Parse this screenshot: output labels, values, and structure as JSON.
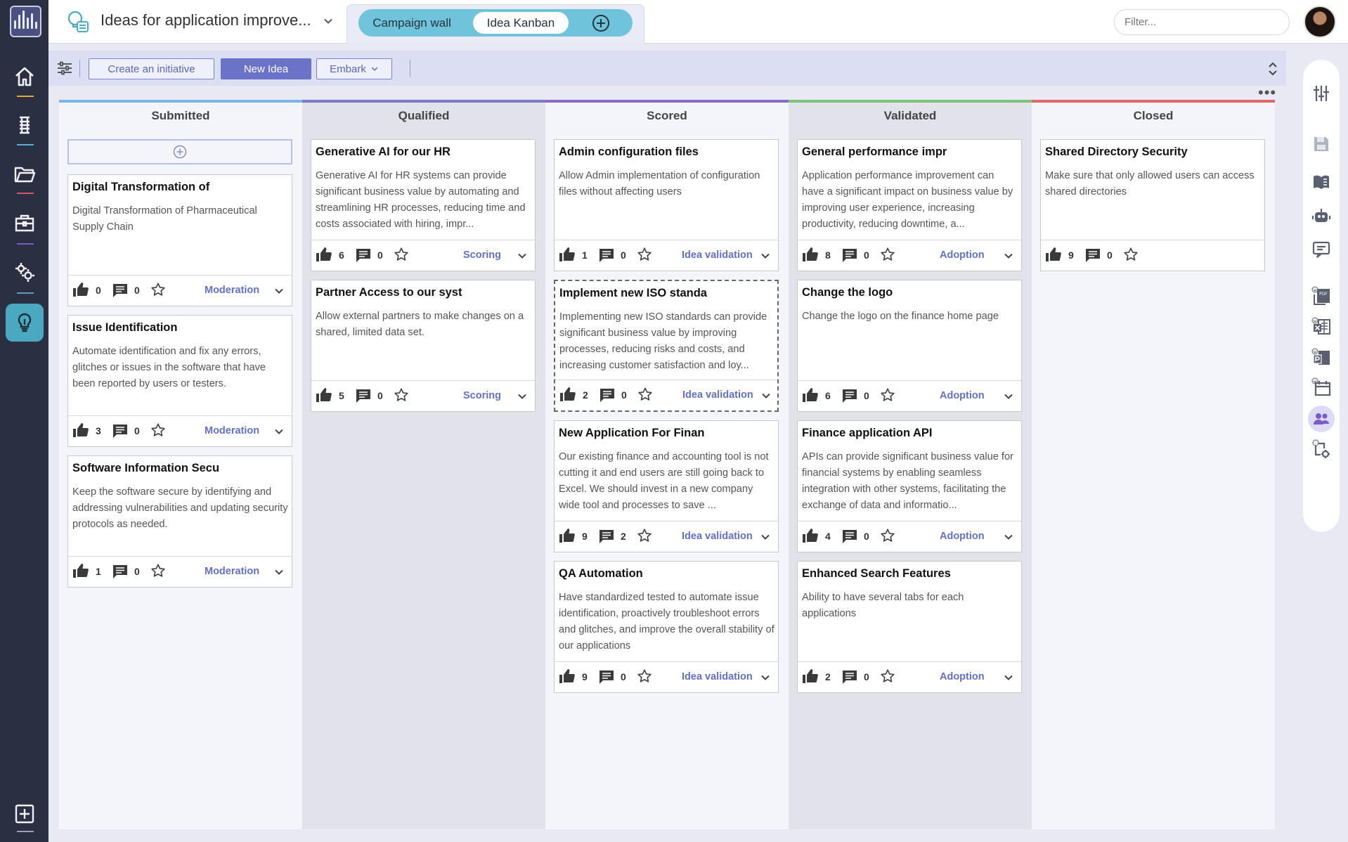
{
  "header": {
    "title": "Ideas for application improve...",
    "tabs": [
      {
        "label": "Campaign wall",
        "active": false
      },
      {
        "label": "Idea Kanban",
        "active": true
      }
    ],
    "filter_placeholder": "Filter..."
  },
  "toolbar": {
    "create_initiative": "Create an initiative",
    "new_idea": "New Idea",
    "embark": "Embark"
  },
  "colors": {
    "submitted": "#7ab6e8",
    "qualified": "#7d78c8",
    "scored": "#8a6cc6",
    "validated": "#7dc47a",
    "closed": "#e06868",
    "accent": "#6b73c9",
    "nav_active": "#4aa8c0"
  },
  "columns": [
    {
      "title": "Submitted",
      "cards": [
        {
          "title": "Digital Transformation of",
          "description": "Digital Transformation of Pharmaceutical Supply Chain",
          "likes": "0",
          "comments": "0",
          "stage": "Moderation"
        },
        {
          "title": "Issue Identification",
          "description": "Automate identification and fix any errors, glitches or issues in the software that have been reported by users or testers.",
          "likes": "3",
          "comments": "0",
          "stage": "Moderation"
        },
        {
          "title": "Software Information Secu",
          "description": "Keep the software secure by identifying and addressing vulnerabilities and updating security protocols as needed.",
          "likes": "1",
          "comments": "0",
          "stage": "Moderation"
        }
      ]
    },
    {
      "title": "Qualified",
      "cards": [
        {
          "title": "Generative AI for our HR",
          "description": "Generative AI for HR systems can provide significant business value by automating and streamlining HR processes, reducing time and costs associated with hiring, impr...",
          "likes": "6",
          "comments": "0",
          "stage": "Scoring"
        },
        {
          "title": "Partner Access to our syst",
          "description": "Allow external partners to make changes on a shared, limited data set.",
          "likes": "5",
          "comments": "0",
          "stage": "Scoring"
        }
      ]
    },
    {
      "title": "Scored",
      "cards": [
        {
          "title": "Admin configuration files",
          "description": "Allow Admin implementation of configuration files without affecting users",
          "likes": "1",
          "comments": "0",
          "stage": "Idea validation"
        },
        {
          "title": "Implement new ISO standa",
          "description": "Implementing new ISO standards can provide significant business value by improving processes, reducing risks and costs, and increasing customer satisfaction and loy...",
          "likes": "2",
          "comments": "0",
          "stage": "Idea validation"
        },
        {
          "title": "New Application For Finan",
          "description": "Our existing finance and accounting tool is not cutting it and end users are still going back to Excel. We should invest in a new company wide tool and processes to save ...",
          "likes": "9",
          "comments": "2",
          "stage": "Idea validation"
        },
        {
          "title": "QA Automation",
          "description": "Have standardized tested to automate issue identification, proactively troubleshoot errors and glitches, and improve the overall stability of our applications",
          "likes": "9",
          "comments": "0",
          "stage": "Idea validation"
        }
      ]
    },
    {
      "title": "Validated",
      "cards": [
        {
          "title": "General performance impr",
          "description": "Application performance improvement can have a significant impact on business value by improving user experience, increasing productivity, reducing downtime, a...",
          "likes": "8",
          "comments": "0",
          "stage": "Adoption"
        },
        {
          "title": "Change the logo",
          "description": "Change the logo on the finance home page",
          "likes": "6",
          "comments": "0",
          "stage": "Adoption"
        },
        {
          "title": "Finance application API",
          "description": "APIs can provide significant business value for financial systems by enabling seamless integration with other systems, facilitating the exchange of data and informatio...",
          "likes": "4",
          "comments": "0",
          "stage": "Adoption"
        },
        {
          "title": "Enhanced Search Features",
          "description": "Ability to have several tabs for each applications",
          "likes": "2",
          "comments": "0",
          "stage": "Adoption"
        }
      ]
    },
    {
      "title": "Closed",
      "cards": [
        {
          "title": "Shared Directory Security",
          "description": "Make sure that only allowed users can access shared directories",
          "likes": "9",
          "comments": "0",
          "stage": ""
        }
      ]
    }
  ]
}
